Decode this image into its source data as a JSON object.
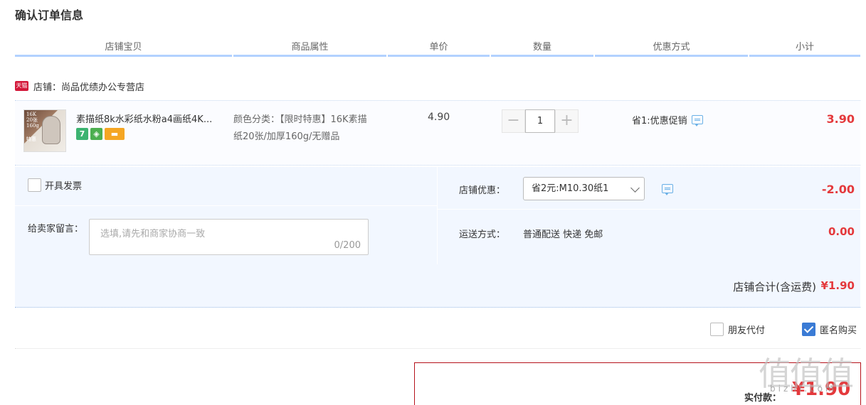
{
  "page_title": "确认订单信息",
  "columns": [
    "店铺宝贝",
    "商品属性",
    "单价",
    "数量",
    "优惠方式",
    "小计"
  ],
  "shop": {
    "badge": "天猫",
    "label": "店铺：尚品优绩办公专营店"
  },
  "item": {
    "thumb_text": [
      "16K",
      "20张",
      "160g"
    ],
    "thumb_text2": "特惠",
    "title": "素描纸8k水彩纸水粉a4画纸4K...",
    "badge_seven": "7",
    "attr_line1": "颜色分类：【限时特惠】16K素描",
    "attr_line2": "纸20张/加厚160g/无赠品",
    "unit_price": "4.90",
    "quantity": "1",
    "minus_label": "−",
    "plus_label": "+",
    "promo": "省1:优惠促销",
    "subtotal": "3.90"
  },
  "options": {
    "invoice_label": "开具发票",
    "message_label": "给卖家留言：",
    "message_placeholder": "选填,请先和商家协商一致",
    "message_count": "0/200",
    "shop_discount_label": "店铺优惠：",
    "shop_discount_selected": "省2元:M10.30纸1",
    "shop_discount_value": "-2.00",
    "shipping_label": "运送方式：",
    "shipping_method": "普通配送 快递 免邮",
    "shipping_value": "0.00",
    "shop_total_label": "店铺合计(含运费)",
    "shop_total_amount": "¥1.90"
  },
  "extras": {
    "friend_pay_label": "朋友代付",
    "friend_pay_checked": false,
    "anonymous_label": "匿名购买",
    "anonymous_checked": true
  },
  "payment": {
    "label": "实付款：",
    "amount": "¥1.90"
  },
  "watermark": {
    "text": "值值值",
    "sub": "bizhi.com"
  },
  "colors": {
    "price_red": "#e4393c",
    "header_underline": "#b2d1ff",
    "panel_bg": "#f2f7ff",
    "check_blue": "#3a7bd5",
    "pay_border": "#b5121b"
  }
}
